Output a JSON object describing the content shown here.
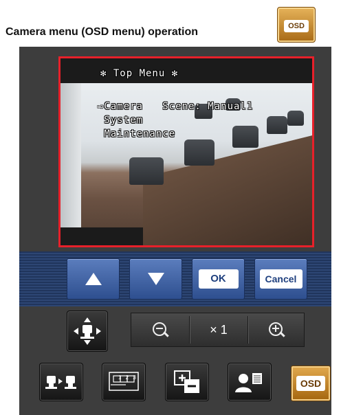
{
  "heading": "Camera menu (OSD menu) operation",
  "osd_badge_label": "OSD",
  "video": {
    "menu_title": "✻ Top Menu ✻",
    "items": [
      {
        "label": "⇨Camera   Scene: Manual1"
      },
      {
        "label": " System"
      },
      {
        "label": " Maintenance"
      }
    ]
  },
  "nav": {
    "up_icon": "arrow-up-icon",
    "down_icon": "arrow-down-icon",
    "ok_label": "OK",
    "cancel_label": "Cancel"
  },
  "controls": {
    "zoom_level": "× 1",
    "osd_label": "OSD",
    "multi_screen_label": "1 2 3"
  },
  "colors": {
    "video_border": "#e8202a",
    "nav_button": "#2e4f8f",
    "osd_button": "#c4852a"
  }
}
